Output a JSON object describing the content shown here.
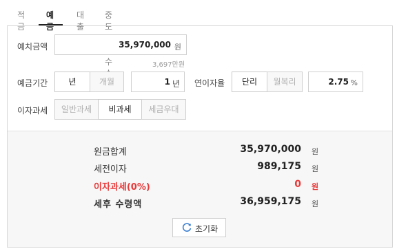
{
  "tabs": [
    "적금",
    "예금",
    "대출",
    "중도상환수수료"
  ],
  "form": {
    "deposit_label": "예치금액",
    "deposit_value": "35,970,000",
    "deposit_unit": "원",
    "deposit_hint": "3,697만원",
    "period_label": "예금기간",
    "period_options": [
      "년",
      "개월"
    ],
    "period_value": "1",
    "period_unit": "년",
    "rate_label": "연이자율",
    "rate_options": [
      "단리",
      "월복리"
    ],
    "rate_value": "2.75",
    "rate_unit": "%",
    "tax_label": "이자과세",
    "tax_options": [
      "일반과세",
      "비과세",
      "세금우대"
    ]
  },
  "results": {
    "total_principal_label": "원금합계",
    "total_principal_value": "35,970,000",
    "pre_tax_interest_label": "세전이자",
    "pre_tax_interest_value": "989,175",
    "interest_tax_label": "이자과세(0%)",
    "interest_tax_value": "0",
    "after_tax_label": "세후 수령액",
    "after_tax_value": "36,959,175",
    "unit": "원"
  },
  "actions": {
    "reset_label": "초기화"
  },
  "colors": {
    "accent_red": "#e83a3a",
    "border": "#cfcfcf",
    "result_bg": "#f7f7f7"
  }
}
